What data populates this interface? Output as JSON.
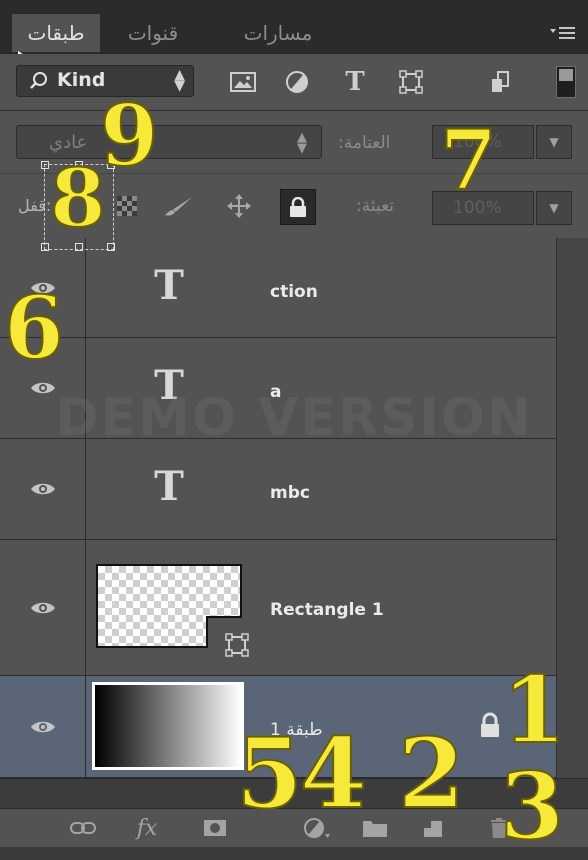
{
  "tabs": [
    {
      "label": "طبقات",
      "active": true
    },
    {
      "label": "قنوات",
      "active": false
    },
    {
      "label": "مسارات",
      "active": false
    }
  ],
  "filter": {
    "kind_label": "Kind",
    "icons": [
      "image-filter-icon",
      "adjustment-filter-icon",
      "type-filter-icon",
      "shape-filter-icon",
      "smart-object-filter-icon"
    ]
  },
  "blend": {
    "mode_label": "عادي",
    "opacity_label": ":العتامة",
    "opacity_value": "100%"
  },
  "lock": {
    "label": "قفل:",
    "fill_label": ":تعبئة",
    "fill_value": "100%"
  },
  "layers": [
    {
      "name": "ction",
      "kind": "type",
      "visible": true
    },
    {
      "name": "a",
      "kind": "type",
      "visible": true
    },
    {
      "name": "mbc",
      "kind": "type",
      "visible": true
    },
    {
      "name": "Rectangle 1",
      "kind": "shape",
      "visible": true
    },
    {
      "name": "طبقة 1",
      "kind": "background",
      "visible": true,
      "locked": true,
      "selected": true
    }
  ],
  "watermark": "DEMO VERSION",
  "toolbar": {
    "fx_label": "fx",
    "icons": [
      "link-layers-icon",
      "layer-style-icon",
      "add-mask-icon",
      "adjustment-layer-icon",
      "new-group-icon",
      "new-layer-icon",
      "delete-layer-icon"
    ]
  },
  "annotations": [
    "9",
    "8",
    "7",
    "6",
    "1",
    "5",
    "4",
    "2",
    "3"
  ],
  "colors": {
    "panel_bg": "#535353",
    "tabbar_bg": "#2b2b2b",
    "selected_row": "#5a6577",
    "annotation": "#f7e93a"
  }
}
